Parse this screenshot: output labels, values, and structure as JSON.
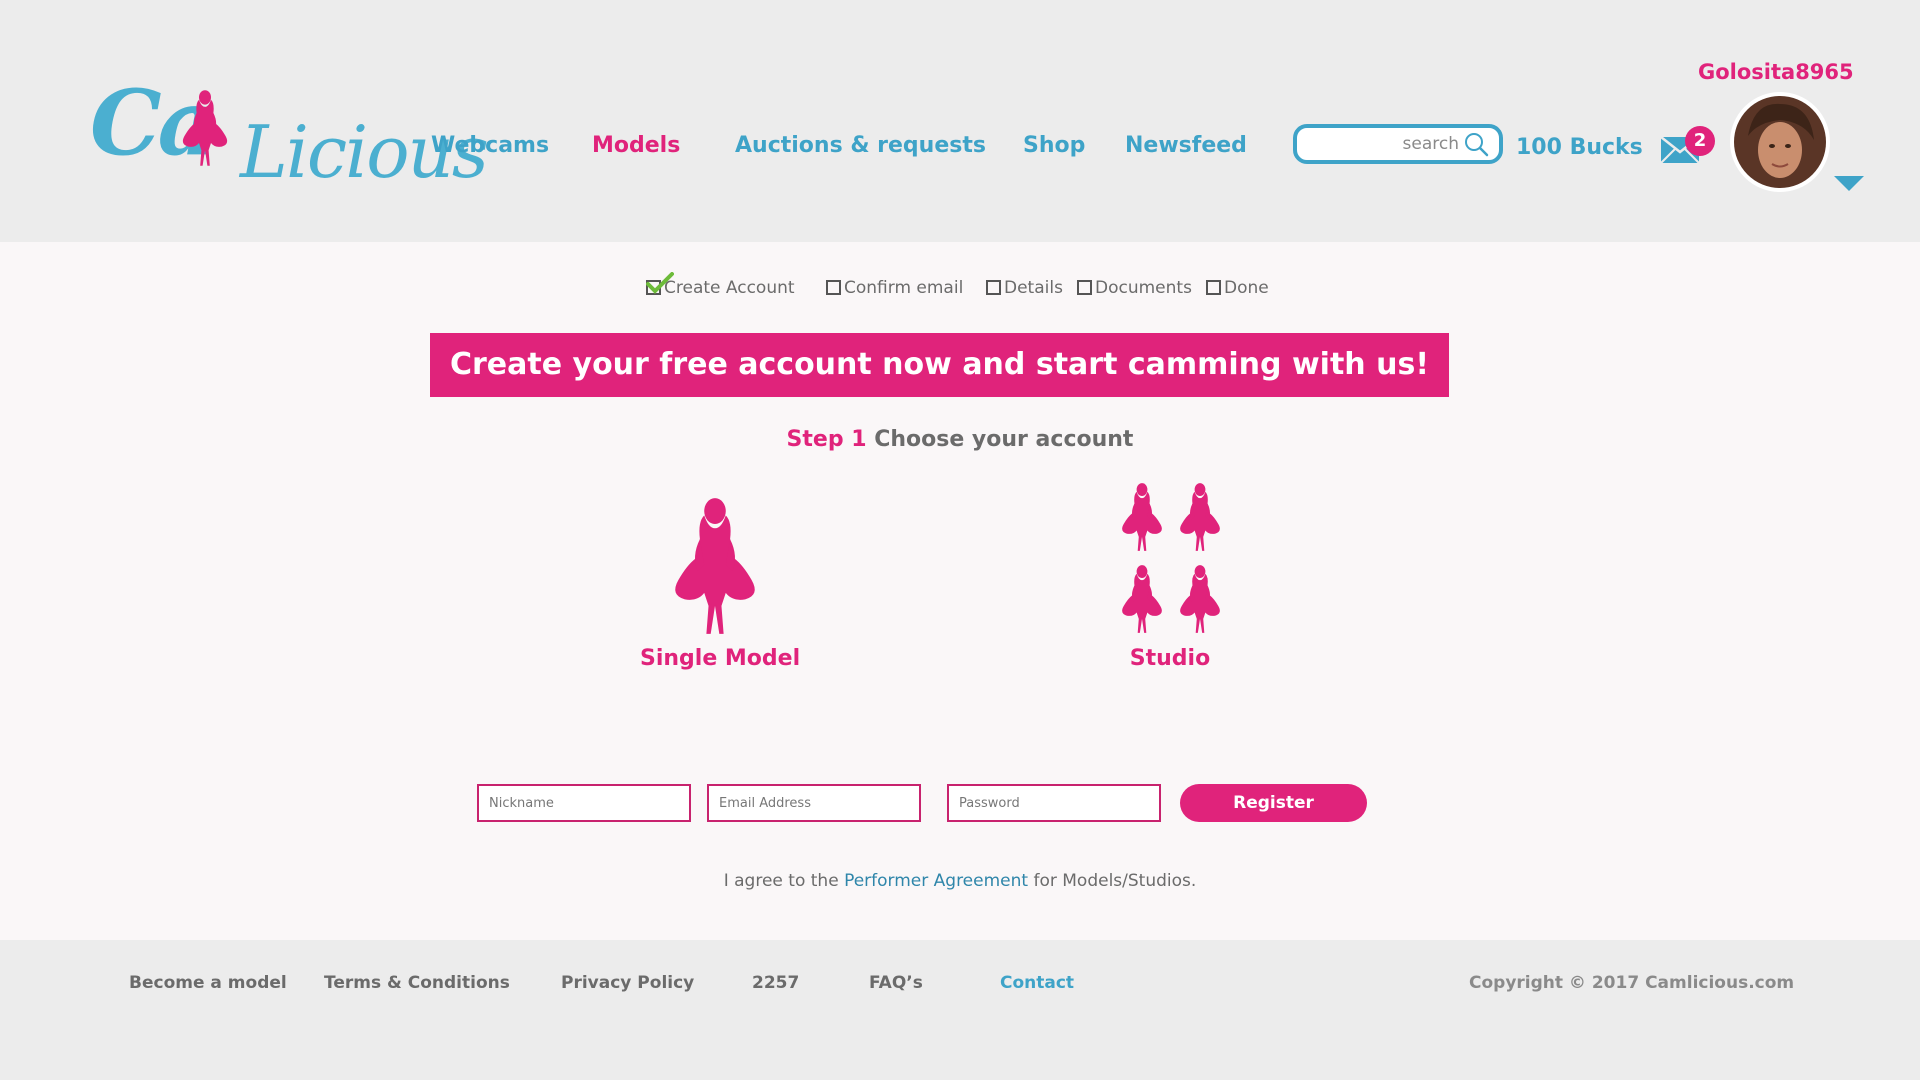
{
  "header": {
    "logo_left": "Ca",
    "logo_right": "Licious",
    "nav": [
      {
        "label": "Webcams"
      },
      {
        "label": "Models"
      },
      {
        "label": "Auctions & requests"
      },
      {
        "label": "Shop"
      },
      {
        "label": "Newsfeed"
      }
    ],
    "search_placeholder": "search",
    "bucks": "100 Bucks",
    "mail_count": "2",
    "username": "Golosita8965"
  },
  "steps": [
    {
      "label": "Create Account",
      "checked": true
    },
    {
      "label": "Confirm email",
      "checked": false
    },
    {
      "label": "Details",
      "checked": false
    },
    {
      "label": "Documents",
      "checked": false
    },
    {
      "label": "Done",
      "checked": false
    }
  ],
  "banner": "Create your free account now and start camming with us!",
  "step_heading": {
    "number": "Step 1",
    "text": "Choose your account"
  },
  "choices": {
    "single": "Single Model",
    "studio": "Studio"
  },
  "form": {
    "nickname_placeholder": "Nickname",
    "email_placeholder": "Email Address",
    "password_placeholder": "Password",
    "register_label": "Register"
  },
  "agreement": {
    "prefix": "I agree to the",
    "link": "Performer Agreement",
    "suffix": "for Models/Studios."
  },
  "footer": {
    "links": [
      {
        "label": "Become a model"
      },
      {
        "label": "Terms & Conditions"
      },
      {
        "label": "Privacy Policy"
      },
      {
        "label": "2257"
      },
      {
        "label": "FAQ’s"
      },
      {
        "label": "Contact"
      }
    ],
    "copyright": "Copyright © 2017 Camlicious.com"
  },
  "colors": {
    "brand_pink": "#e0237b",
    "brand_blue": "#3ea3c8",
    "header_bg": "#ececec"
  }
}
